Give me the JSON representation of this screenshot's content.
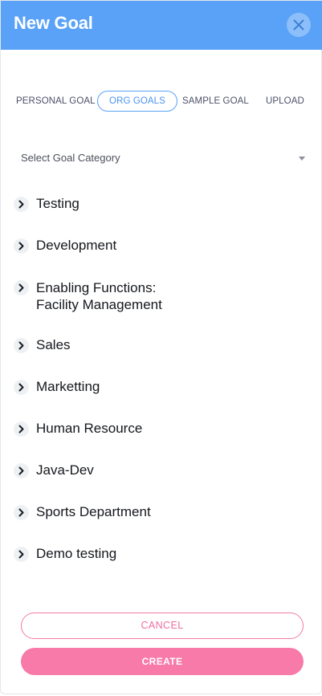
{
  "header": {
    "title": "New Goal",
    "background_color": "#5aa2f7",
    "close_icon": "close-icon"
  },
  "tabs": [
    {
      "label": "PERSONAL GOAL",
      "active": false
    },
    {
      "label": "ORG GOALS",
      "active": true
    },
    {
      "label": "SAMPLE GOAL",
      "active": false
    },
    {
      "label": "UPLOAD",
      "active": false
    }
  ],
  "category_select": {
    "placeholder": "Select Goal Category"
  },
  "goal_categories": [
    {
      "label": "Testing"
    },
    {
      "label": "Development"
    },
    {
      "label": "Enabling Functions:\nFacility Management"
    },
    {
      "label": "Sales"
    },
    {
      "label": "Marketting"
    },
    {
      "label": "Human Resource"
    },
    {
      "label": "Java-Dev"
    },
    {
      "label": "Sports Department"
    },
    {
      "label": "Demo testing"
    }
  ],
  "actions": {
    "cancel_label": "CANCEL",
    "create_label": "CREATE",
    "accent_color": "#f77aa8"
  }
}
